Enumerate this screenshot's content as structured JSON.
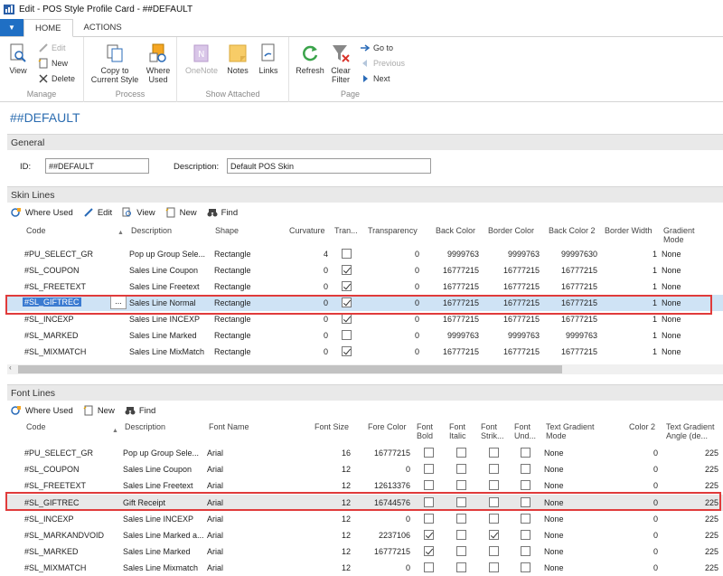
{
  "window": {
    "title": "Edit - POS Style Profile Card - ##DEFAULT"
  },
  "ribbon": {
    "tabs": [
      "HOME",
      "ACTIONS"
    ],
    "manage": {
      "label": "Manage",
      "view": "View",
      "edit": "Edit",
      "new": "New",
      "delete": "Delete"
    },
    "process": {
      "label": "Process",
      "copy": "Copy to Current Style",
      "where_used": "Where Used"
    },
    "attached": {
      "label": "Show Attached",
      "onenote": "OneNote",
      "notes": "Notes",
      "links": "Links"
    },
    "page": {
      "label": "Page",
      "refresh": "Refresh",
      "clear_filter": "Clear Filter",
      "goto": "Go to",
      "previous": "Previous",
      "next": "Next"
    }
  },
  "page_title": "##DEFAULT",
  "general": {
    "header": "General",
    "id_label": "ID:",
    "id_value": "##DEFAULT",
    "desc_label": "Description:",
    "desc_value": "Default POS Skin"
  },
  "skin": {
    "header": "Skin Lines",
    "toolbar": [
      "Where Used",
      "Edit",
      "View",
      "New",
      "Find"
    ],
    "columns": [
      "Code",
      "Description",
      "Shape",
      "Curvature",
      "Tran...",
      "Transparency",
      "Back Color",
      "Border Color",
      "Back Color 2",
      "Border Width",
      "Gradient Mode"
    ],
    "rows": [
      {
        "code": "#PU_SELECT_GR",
        "desc": "Pop up Group Sele...",
        "shape": "Rectangle",
        "curv": "4",
        "tran": false,
        "transp": "0",
        "back": "9999763",
        "border": "9999763",
        "back2": "99997630",
        "bw": "1",
        "grad": "None"
      },
      {
        "code": "#SL_COUPON",
        "desc": "Sales Line Coupon",
        "shape": "Rectangle",
        "curv": "0",
        "tran": true,
        "transp": "0",
        "back": "16777215",
        "border": "16777215",
        "back2": "16777215",
        "bw": "1",
        "grad": "None"
      },
      {
        "code": "#SL_FREETEXT",
        "desc": "Sales Line Freetext",
        "shape": "Rectangle",
        "curv": "0",
        "tran": true,
        "transp": "0",
        "back": "16777215",
        "border": "16777215",
        "back2": "16777215",
        "bw": "1",
        "grad": "None"
      },
      {
        "code": "#SL_GIFTREC",
        "desc": "Sales Line Normal",
        "shape": "Rectangle",
        "curv": "0",
        "tran": true,
        "transp": "0",
        "back": "16777215",
        "border": "16777215",
        "back2": "16777215",
        "bw": "1",
        "grad": "None"
      },
      {
        "code": "#SL_INCEXP",
        "desc": "Sales Line INCEXP",
        "shape": "Rectangle",
        "curv": "0",
        "tran": true,
        "transp": "0",
        "back": "16777215",
        "border": "16777215",
        "back2": "16777215",
        "bw": "1",
        "grad": "None"
      },
      {
        "code": "#SL_MARKED",
        "desc": "Sales Line Marked",
        "shape": "Rectangle",
        "curv": "0",
        "tran": false,
        "transp": "0",
        "back": "9999763",
        "border": "9999763",
        "back2": "9999763",
        "bw": "1",
        "grad": "None"
      },
      {
        "code": "#SL_MIXMATCH",
        "desc": "Sales Line MixMatch",
        "shape": "Rectangle",
        "curv": "0",
        "tran": true,
        "transp": "0",
        "back": "16777215",
        "border": "16777215",
        "back2": "16777215",
        "bw": "1",
        "grad": "None"
      }
    ],
    "ellipsis": "..."
  },
  "font": {
    "header": "Font Lines",
    "toolbar": [
      "Where Used",
      "New",
      "Find"
    ],
    "columns": [
      "Code",
      "Description",
      "Font Name",
      "Font Size",
      "Fore Color",
      "Font Bold",
      "Font Italic",
      "Font Strik...",
      "Font Und...",
      "Text Gradient Mode",
      "Color 2",
      "Text Gradient Angle (de..."
    ],
    "rows": [
      {
        "code": "#PU_SELECT_GR",
        "desc": "Pop up Group Sele...",
        "font": "Arial",
        "size": "16",
        "fore": "16777215",
        "bold": false,
        "italic": false,
        "strike": false,
        "und": false,
        "mode": "None",
        "color2": "0",
        "angle": "225"
      },
      {
        "code": "#SL_COUPON",
        "desc": "Sales Line Coupon",
        "font": "Arial",
        "size": "12",
        "fore": "0",
        "bold": false,
        "italic": false,
        "strike": false,
        "und": false,
        "mode": "None",
        "color2": "0",
        "angle": "225"
      },
      {
        "code": "#SL_FREETEXT",
        "desc": "Sales Line Freetext",
        "font": "Arial",
        "size": "12",
        "fore": "12613376",
        "bold": false,
        "italic": false,
        "strike": false,
        "und": false,
        "mode": "None",
        "color2": "0",
        "angle": "225"
      },
      {
        "code": "#SL_GIFTREC",
        "desc": "Gift Receipt",
        "font": "Arial",
        "size": "12",
        "fore": "16744576",
        "bold": false,
        "italic": false,
        "strike": false,
        "und": false,
        "mode": "None",
        "color2": "0",
        "angle": "225"
      },
      {
        "code": "#SL_INCEXP",
        "desc": "Sales Line INCEXP",
        "font": "Arial",
        "size": "12",
        "fore": "0",
        "bold": false,
        "italic": false,
        "strike": false,
        "und": false,
        "mode": "None",
        "color2": "0",
        "angle": "225"
      },
      {
        "code": "#SL_MARKANDVOID",
        "desc": "Sales Line Marked a...",
        "font": "Arial",
        "size": "12",
        "fore": "2237106",
        "bold": true,
        "italic": false,
        "strike": true,
        "und": false,
        "mode": "None",
        "color2": "0",
        "angle": "225"
      },
      {
        "code": "#SL_MARKED",
        "desc": "Sales Line Marked",
        "font": "Arial",
        "size": "12",
        "fore": "16777215",
        "bold": true,
        "italic": false,
        "strike": false,
        "und": false,
        "mode": "None",
        "color2": "0",
        "angle": "225"
      },
      {
        "code": "#SL_MIXMATCH",
        "desc": "Sales Line Mixmatch",
        "font": "Arial",
        "size": "12",
        "fore": "0",
        "bold": false,
        "italic": false,
        "strike": false,
        "und": false,
        "mode": "None",
        "color2": "0",
        "angle": "225"
      }
    ]
  },
  "colors": {
    "accent": "#1f6fc4",
    "highlight": "#e03b3b",
    "selected": "#cfe3f5"
  }
}
